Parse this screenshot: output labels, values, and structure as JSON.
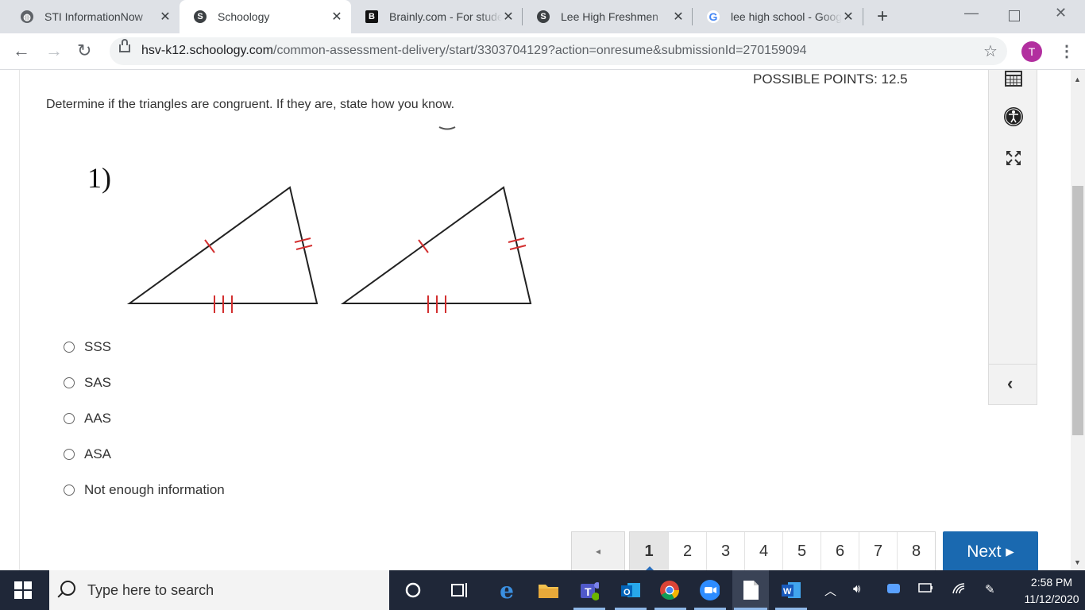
{
  "browser": {
    "tabs": [
      {
        "title": "STI InformationNow",
        "favicon": "globe-icon",
        "active": false
      },
      {
        "title": "Schoology",
        "favicon": "schoology-icon",
        "active": true
      },
      {
        "title": "Brainly.com - For students",
        "favicon": "brainly-icon",
        "active": false
      },
      {
        "title": "Lee High Freshmen",
        "favicon": "schoology-icon",
        "active": false
      },
      {
        "title": "lee high school - Google Search",
        "favicon": "google-icon",
        "active": false
      }
    ],
    "new_tab": "+",
    "url_host": "hsv-k12.schoology.com",
    "url_path": "/common-assessment-delivery/start/3303704129?action=onresume&submissionId=270159094",
    "avatar_letter": "T",
    "avatar_color": "#b22f9f"
  },
  "assessment": {
    "possible_points": "POSSIBLE POINTS: 12.5",
    "question": "Determine if the triangles are congruent. If they are, state how you know.",
    "figure_label": "1)",
    "choices": [
      "SSS",
      "SAS",
      "AAS",
      "ASA",
      "Not enough information"
    ],
    "pagination": {
      "prev_symbol": "◂",
      "pages": [
        "1",
        "2",
        "3",
        "4",
        "5",
        "6",
        "7",
        "8"
      ],
      "current": "1",
      "next_label": "Next ▸"
    },
    "tools": [
      "calendar-icon",
      "accessibility-icon",
      "fullscreen-icon"
    ],
    "collapse_symbol": "‹"
  },
  "taskbar": {
    "search_placeholder": "Type here to search",
    "time": "2:58 PM",
    "date": "11/12/2020",
    "apps": [
      "cortana-icon",
      "task-view-icon",
      "edge-icon",
      "file-explorer-icon",
      "teams-icon",
      "outlook-icon",
      "chrome-icon",
      "zoom-icon",
      "notepad-icon",
      "word-icon"
    ]
  },
  "colors": {
    "accent": "#1a69b0",
    "tick_marks": "#d32f2f",
    "taskbar": "#1f2738"
  }
}
